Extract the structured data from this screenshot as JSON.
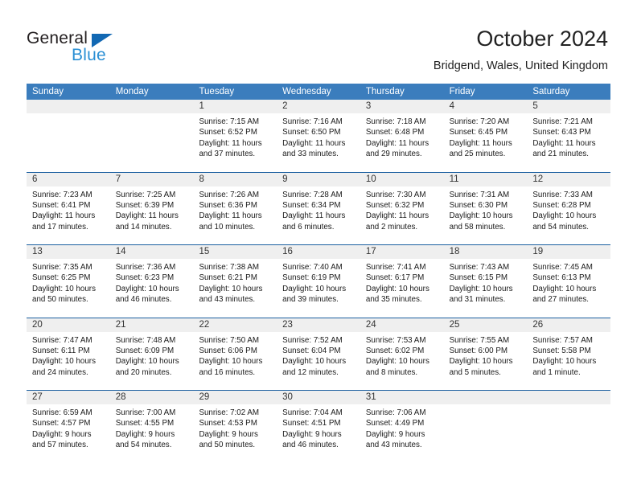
{
  "brand": {
    "name_part1": "General",
    "name_part2": "Blue",
    "accent_color": "#2a8fd4",
    "triangle_color": "#1268b3"
  },
  "header": {
    "title": "October 2024",
    "subtitle": "Bridgend, Wales, United Kingdom"
  },
  "calendar": {
    "header_bg": "#3b7dbd",
    "row_rule_color": "#1b5fa0",
    "daynum_band_bg": "#efefef",
    "weekdays": [
      "Sunday",
      "Monday",
      "Tuesday",
      "Wednesday",
      "Thursday",
      "Friday",
      "Saturday"
    ],
    "weeks": [
      [
        {
          "day": "",
          "lines": []
        },
        {
          "day": "",
          "lines": []
        },
        {
          "day": "1",
          "lines": [
            "Sunrise: 7:15 AM",
            "Sunset: 6:52 PM",
            "Daylight: 11 hours",
            "and 37 minutes."
          ]
        },
        {
          "day": "2",
          "lines": [
            "Sunrise: 7:16 AM",
            "Sunset: 6:50 PM",
            "Daylight: 11 hours",
            "and 33 minutes."
          ]
        },
        {
          "day": "3",
          "lines": [
            "Sunrise: 7:18 AM",
            "Sunset: 6:48 PM",
            "Daylight: 11 hours",
            "and 29 minutes."
          ]
        },
        {
          "day": "4",
          "lines": [
            "Sunrise: 7:20 AM",
            "Sunset: 6:45 PM",
            "Daylight: 11 hours",
            "and 25 minutes."
          ]
        },
        {
          "day": "5",
          "lines": [
            "Sunrise: 7:21 AM",
            "Sunset: 6:43 PM",
            "Daylight: 11 hours",
            "and 21 minutes."
          ]
        }
      ],
      [
        {
          "day": "6",
          "lines": [
            "Sunrise: 7:23 AM",
            "Sunset: 6:41 PM",
            "Daylight: 11 hours",
            "and 17 minutes."
          ]
        },
        {
          "day": "7",
          "lines": [
            "Sunrise: 7:25 AM",
            "Sunset: 6:39 PM",
            "Daylight: 11 hours",
            "and 14 minutes."
          ]
        },
        {
          "day": "8",
          "lines": [
            "Sunrise: 7:26 AM",
            "Sunset: 6:36 PM",
            "Daylight: 11 hours",
            "and 10 minutes."
          ]
        },
        {
          "day": "9",
          "lines": [
            "Sunrise: 7:28 AM",
            "Sunset: 6:34 PM",
            "Daylight: 11 hours",
            "and 6 minutes."
          ]
        },
        {
          "day": "10",
          "lines": [
            "Sunrise: 7:30 AM",
            "Sunset: 6:32 PM",
            "Daylight: 11 hours",
            "and 2 minutes."
          ]
        },
        {
          "day": "11",
          "lines": [
            "Sunrise: 7:31 AM",
            "Sunset: 6:30 PM",
            "Daylight: 10 hours",
            "and 58 minutes."
          ]
        },
        {
          "day": "12",
          "lines": [
            "Sunrise: 7:33 AM",
            "Sunset: 6:28 PM",
            "Daylight: 10 hours",
            "and 54 minutes."
          ]
        }
      ],
      [
        {
          "day": "13",
          "lines": [
            "Sunrise: 7:35 AM",
            "Sunset: 6:25 PM",
            "Daylight: 10 hours",
            "and 50 minutes."
          ]
        },
        {
          "day": "14",
          "lines": [
            "Sunrise: 7:36 AM",
            "Sunset: 6:23 PM",
            "Daylight: 10 hours",
            "and 46 minutes."
          ]
        },
        {
          "day": "15",
          "lines": [
            "Sunrise: 7:38 AM",
            "Sunset: 6:21 PM",
            "Daylight: 10 hours",
            "and 43 minutes."
          ]
        },
        {
          "day": "16",
          "lines": [
            "Sunrise: 7:40 AM",
            "Sunset: 6:19 PM",
            "Daylight: 10 hours",
            "and 39 minutes."
          ]
        },
        {
          "day": "17",
          "lines": [
            "Sunrise: 7:41 AM",
            "Sunset: 6:17 PM",
            "Daylight: 10 hours",
            "and 35 minutes."
          ]
        },
        {
          "day": "18",
          "lines": [
            "Sunrise: 7:43 AM",
            "Sunset: 6:15 PM",
            "Daylight: 10 hours",
            "and 31 minutes."
          ]
        },
        {
          "day": "19",
          "lines": [
            "Sunrise: 7:45 AM",
            "Sunset: 6:13 PM",
            "Daylight: 10 hours",
            "and 27 minutes."
          ]
        }
      ],
      [
        {
          "day": "20",
          "lines": [
            "Sunrise: 7:47 AM",
            "Sunset: 6:11 PM",
            "Daylight: 10 hours",
            "and 24 minutes."
          ]
        },
        {
          "day": "21",
          "lines": [
            "Sunrise: 7:48 AM",
            "Sunset: 6:09 PM",
            "Daylight: 10 hours",
            "and 20 minutes."
          ]
        },
        {
          "day": "22",
          "lines": [
            "Sunrise: 7:50 AM",
            "Sunset: 6:06 PM",
            "Daylight: 10 hours",
            "and 16 minutes."
          ]
        },
        {
          "day": "23",
          "lines": [
            "Sunrise: 7:52 AM",
            "Sunset: 6:04 PM",
            "Daylight: 10 hours",
            "and 12 minutes."
          ]
        },
        {
          "day": "24",
          "lines": [
            "Sunrise: 7:53 AM",
            "Sunset: 6:02 PM",
            "Daylight: 10 hours",
            "and 8 minutes."
          ]
        },
        {
          "day": "25",
          "lines": [
            "Sunrise: 7:55 AM",
            "Sunset: 6:00 PM",
            "Daylight: 10 hours",
            "and 5 minutes."
          ]
        },
        {
          "day": "26",
          "lines": [
            "Sunrise: 7:57 AM",
            "Sunset: 5:58 PM",
            "Daylight: 10 hours",
            "and 1 minute."
          ]
        }
      ],
      [
        {
          "day": "27",
          "lines": [
            "Sunrise: 6:59 AM",
            "Sunset: 4:57 PM",
            "Daylight: 9 hours",
            "and 57 minutes."
          ]
        },
        {
          "day": "28",
          "lines": [
            "Sunrise: 7:00 AM",
            "Sunset: 4:55 PM",
            "Daylight: 9 hours",
            "and 54 minutes."
          ]
        },
        {
          "day": "29",
          "lines": [
            "Sunrise: 7:02 AM",
            "Sunset: 4:53 PM",
            "Daylight: 9 hours",
            "and 50 minutes."
          ]
        },
        {
          "day": "30",
          "lines": [
            "Sunrise: 7:04 AM",
            "Sunset: 4:51 PM",
            "Daylight: 9 hours",
            "and 46 minutes."
          ]
        },
        {
          "day": "31",
          "lines": [
            "Sunrise: 7:06 AM",
            "Sunset: 4:49 PM",
            "Daylight: 9 hours",
            "and 43 minutes."
          ]
        },
        {
          "day": "",
          "lines": []
        },
        {
          "day": "",
          "lines": []
        }
      ]
    ]
  }
}
